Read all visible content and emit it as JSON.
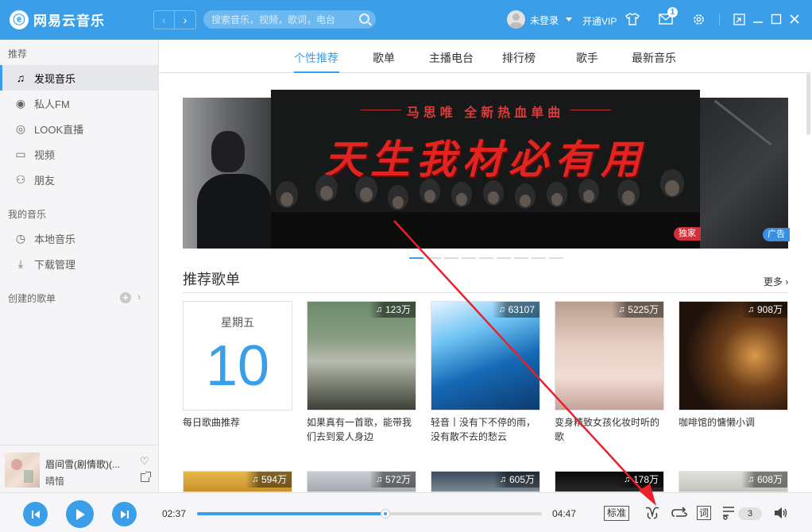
{
  "app": {
    "logo_glyph": "ⓔ",
    "name": "网易云音乐"
  },
  "search": {
    "placeholder": "搜索音乐，视频，歌词，电台"
  },
  "user": {
    "login_label": "未登录",
    "vip_label": "开通VIP",
    "message_count": "1"
  },
  "sidebar": {
    "recommend_header": "推荐",
    "recommend_items": [
      {
        "label": "发现音乐",
        "icon": "music-note-icon",
        "glyph": "♫"
      },
      {
        "label": "私人FM",
        "icon": "radio-icon",
        "glyph": "◉"
      },
      {
        "label": "LOOK直播",
        "icon": "live-icon",
        "glyph": "◎"
      },
      {
        "label": "视频",
        "icon": "video-icon",
        "glyph": "▭"
      },
      {
        "label": "朋友",
        "icon": "friends-icon",
        "glyph": "⚇"
      }
    ],
    "my_music_header": "我的音乐",
    "my_music_items": [
      {
        "label": "本地音乐",
        "icon": "local-music-icon",
        "glyph": "◷"
      },
      {
        "label": "下载管理",
        "icon": "download-icon",
        "glyph": "⤓"
      }
    ],
    "created_header": "创建的歌单"
  },
  "now_playing": {
    "title": "眉间雪(剧情歌)(...",
    "artist": "晴愔"
  },
  "tabs": [
    "个性推荐",
    "歌单",
    "主播电台",
    "排行榜",
    "歌手",
    "最新音乐"
  ],
  "banner": {
    "subtitle": "马思唯  全新热血单曲",
    "title": "天生我材必有用",
    "tag_exclusive": "独家",
    "tag_ad": "广告"
  },
  "section": {
    "title": "推荐歌单",
    "more_label": "更多"
  },
  "daily": {
    "weekday": "星期五",
    "day": "10",
    "name": "每日歌曲推荐"
  },
  "playlists_row1": [
    {
      "count": "123万",
      "name": "如果真有一首歌，能带我们去到爱人身边"
    },
    {
      "count": "63107",
      "name": "轻音丨没有下不停的雨，没有散不去的愁云"
    },
    {
      "count": "5225万",
      "name": "变身精致女孩化妆时听的歌"
    },
    {
      "count": "908万",
      "name": "咖啡馆的慵懒小调"
    }
  ],
  "playlists_row2": [
    {
      "count": "594万"
    },
    {
      "count": "572万"
    },
    {
      "count": "605万"
    },
    {
      "count": "178万"
    },
    {
      "count": "608万"
    }
  ],
  "player": {
    "current_time": "02:37",
    "total_time": "04:47",
    "progress_fraction": 0.547,
    "quality_label": "标准",
    "lyric_label": "词",
    "queue_count": "3"
  },
  "colors": {
    "accent": "#3a9fe8",
    "banner_red": "#e2231f"
  }
}
